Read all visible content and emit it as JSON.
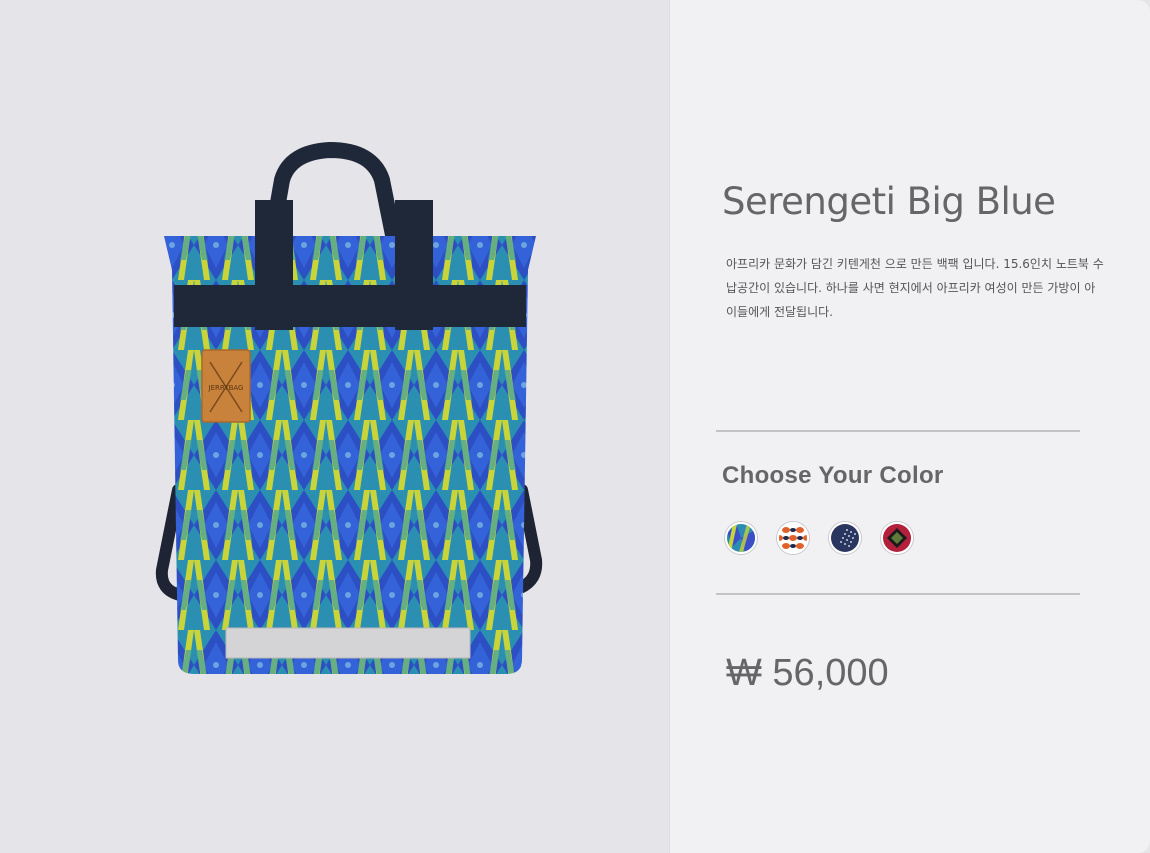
{
  "product": {
    "title": "Serengeti Big Blue",
    "description": "아프리카 문화가 담긴 키텐게천 으로 만든 백팩 입니다. 15.6인치 노트북 수납공간이 있습니다. 하나를 사면 현지에서 아프리카 여성이 만든 가방이 아이들에게 전달됩니다.",
    "brand_label": "JERRYBAG",
    "price": "₩ 56,000"
  },
  "color_picker": {
    "heading": "Choose Your Color",
    "options": [
      {
        "name": "serengeti-blue",
        "icon": "blue-green-pattern"
      },
      {
        "name": "orange-navy",
        "icon": "orange-navy-pattern"
      },
      {
        "name": "navy-dots",
        "icon": "navy-dot-pattern"
      },
      {
        "name": "red-green",
        "icon": "red-green-pattern"
      }
    ]
  },
  "colors": {
    "left_bg": "#e5e5e9",
    "right_bg": "#f1f1f4",
    "text": "#666568",
    "divider": "#c3c3c7"
  }
}
